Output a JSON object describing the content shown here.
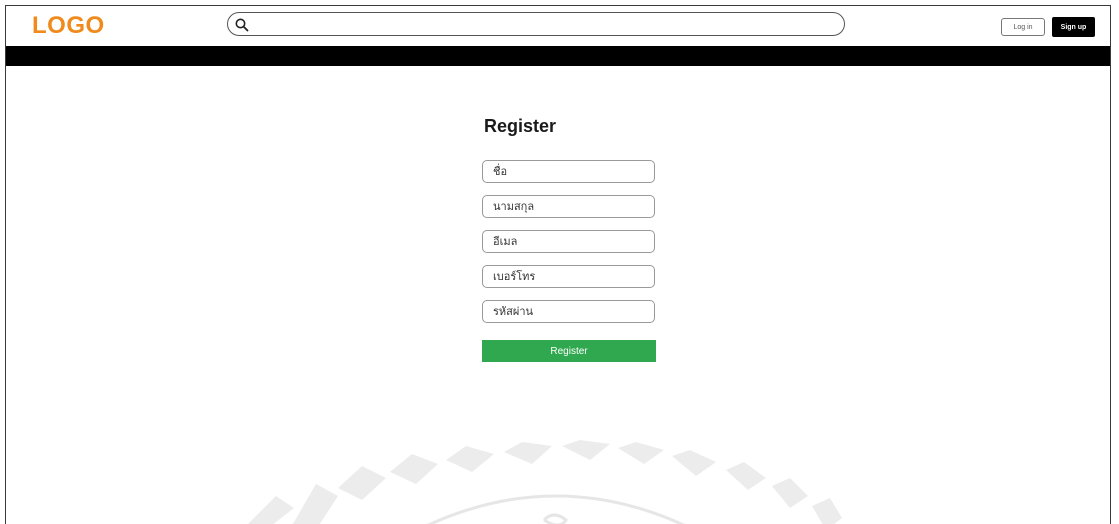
{
  "header": {
    "logo": "LOGO",
    "search": {
      "placeholder": "",
      "value": ""
    },
    "login_label": "Log in",
    "signup_label": "Sign up"
  },
  "form": {
    "title": "Register",
    "fields": [
      {
        "placeholder": "ชื่อ"
      },
      {
        "placeholder": "นามสกุล"
      },
      {
        "placeholder": "อีเมล"
      },
      {
        "placeholder": "เบอร์โทร"
      },
      {
        "placeholder": "รหัสผ่าน"
      }
    ],
    "submit_label": "Register",
    "submit_color": "#2fa84f"
  },
  "theme": {
    "logo_color": "#f08a1c",
    "navbar_color": "#000000"
  },
  "icons": {
    "search": "search-icon",
    "watermark": "watermark-emblem-icon"
  }
}
